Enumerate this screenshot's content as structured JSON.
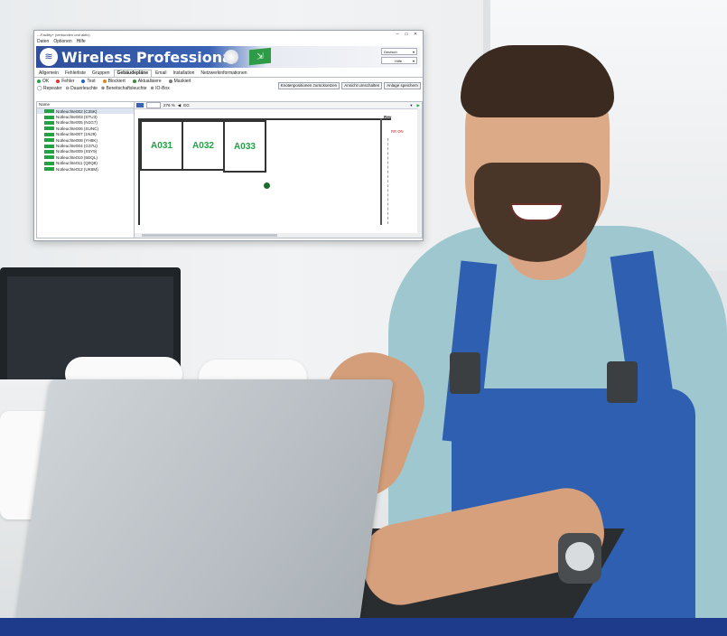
{
  "window": {
    "title": "---Facility+ (verbunden und aktiv)",
    "controls": [
      "–",
      "▭",
      "✕"
    ]
  },
  "menu": [
    "Daten",
    "Optionen",
    "Hilfe"
  ],
  "banner": {
    "brand": "Wireless Professional",
    "language": "Deutsch",
    "help": "Hilfe"
  },
  "tabs": [
    "Allgemein",
    "Fehlerliste",
    "Gruppen",
    "Gebäudepläne",
    "Email",
    "Installation",
    "Netzwerkinformationen"
  ],
  "active_tab": "Gebäudepläne",
  "status_legend": [
    {
      "label": "OK",
      "color": "#22a344"
    },
    {
      "label": "Fehler",
      "color": "#d33"
    },
    {
      "label": "Test",
      "color": "#2b5fbf"
    },
    {
      "label": "Blockiert",
      "color": "#d58a1b"
    },
    {
      "label": "Aktualisiere",
      "color": "#3a8a3a"
    },
    {
      "label": "Maskiert",
      "color": "#7a7a7a"
    }
  ],
  "device_legend": [
    "Repeater",
    "Dauerleuchte",
    "Bereitschaftsleuchte",
    "IO-Box"
  ],
  "actions": [
    "Knotenpositionen zurücksetzen",
    "Ansicht umschalten",
    "Anlage speichern"
  ],
  "list": {
    "header": "Name",
    "items": [
      "Notleuchte002 (C25K)",
      "Notleuchte003 (STU3)",
      "Notleuchte005 (N1G7)",
      "Notleuchte006 (SUNC)",
      "Notleuchte007 (1NJ9)",
      "Notleuchte008 (YH8K)",
      "Notleuchte004 (G37U)",
      "Notleuchte009 (X5Y9)",
      "Notleuchte010 (5DQL)",
      "Notleuchte011 (Q0Q8)",
      "Notleuchte012 (UK8M)"
    ],
    "status": "OK"
  },
  "plan": {
    "zoom": "276 %",
    "floor": "EG",
    "rooms": [
      "A031",
      "A032",
      "A033"
    ],
    "side_label": "Rev",
    "side_label2": "RR ON"
  }
}
